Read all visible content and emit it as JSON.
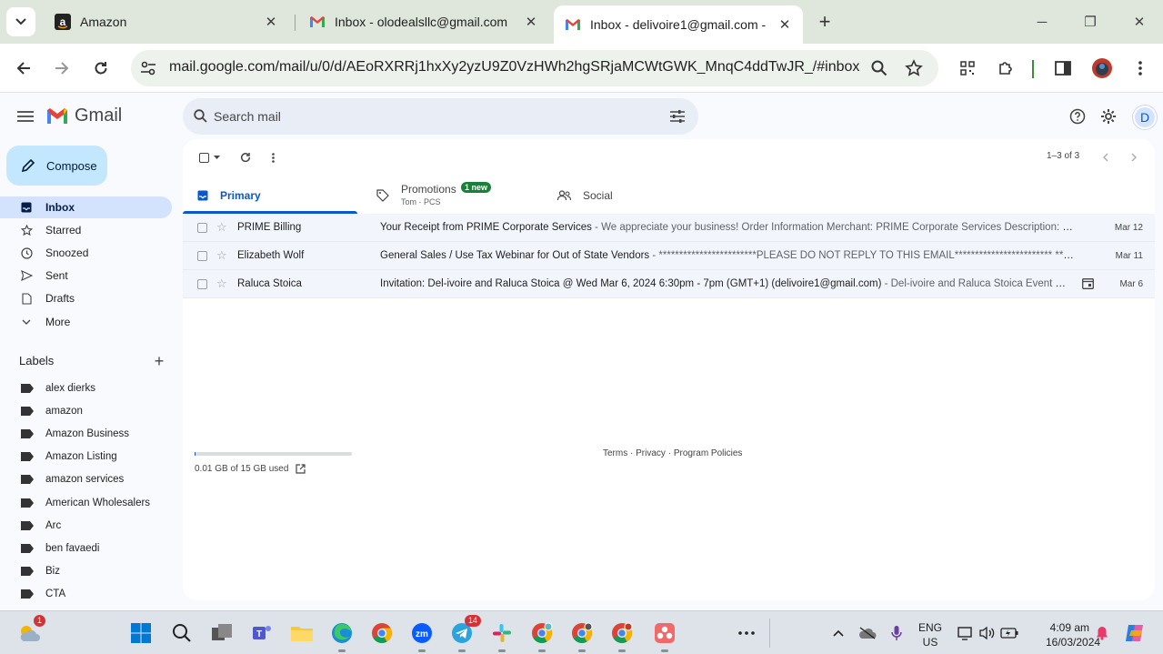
{
  "browser": {
    "tabs": [
      {
        "title": "Amazon",
        "icon": "amazon-icon"
      },
      {
        "title": "Inbox - olodealsllc@gmail.com",
        "icon": "gmail-icon"
      },
      {
        "title": "Inbox - delivoire1@gmail.com -",
        "icon": "gmail-icon",
        "active": true
      }
    ],
    "url": "mail.google.com/mail/u/0/d/AEoRXRRj1hxXy2yzU9Z0VzHWh2hgSRjaMCWtGWK_MnqC4ddTwJR_/#inbox"
  },
  "gmail": {
    "logo_text": "Gmail",
    "search_placeholder": "Search mail",
    "avatar_letter": "D",
    "compose_label": "Compose",
    "nav": [
      {
        "label": "Inbox",
        "icon": "inbox-icon",
        "active": true
      },
      {
        "label": "Starred",
        "icon": "star-icon"
      },
      {
        "label": "Snoozed",
        "icon": "clock-icon"
      },
      {
        "label": "Sent",
        "icon": "send-icon"
      },
      {
        "label": "Drafts",
        "icon": "draft-icon"
      },
      {
        "label": "More",
        "icon": "chevron-down-icon"
      }
    ],
    "labels_heading": "Labels",
    "labels": [
      "alex dierks",
      "amazon",
      "Amazon Business",
      "Amazon Listing",
      "amazon services",
      "American Wholesalers",
      "Arc",
      "ben favaedi",
      "Biz",
      "CTA"
    ],
    "pagination": "1–3 of 3",
    "categories": [
      {
        "label": "Primary",
        "active": true
      },
      {
        "label": "Promotions",
        "badge": "1 new",
        "sub": "Tom · PCS"
      },
      {
        "label": "Social"
      }
    ],
    "emails": [
      {
        "sender": "PRIME Billing",
        "subject": "Your Receipt from PRIME Corporate Services",
        "snippet": " - We appreciate your business! Order Information Merchant: PRIME Corporate Services Description: Regist...",
        "date": "Mar 12"
      },
      {
        "sender": "Elizabeth Wolf",
        "subject": "General Sales / Use Tax Webinar for Out of State Vendors",
        "snippet": " - ************************PLEASE DO NOT REPLY TO THIS EMAIL************************ *******...",
        "date": "Mar 11"
      },
      {
        "sender": "Raluca Stoica",
        "subject": "Invitation: Del-ivoire and Raluca Stoica @ Wed Mar 6, 2024 6:30pm - 7pm (GMT+1) (delivoire1@gmail.com)",
        "snippet": " - Del-ivoire and Raluca Stoica Event Name: W...",
        "date": "Mar 6",
        "has_calendar": true
      }
    ],
    "storage_text": "0.01 GB of 15 GB used",
    "storage_fraction": 0.001,
    "footer_links": [
      "Terms",
      "Privacy",
      "Program Policies"
    ]
  },
  "taskbar": {
    "weather_badge": "1",
    "telegram_badge": "14",
    "lang_line1": "ENG",
    "lang_line2": "US",
    "time": "4:09 am",
    "date": "16/03/2024"
  }
}
